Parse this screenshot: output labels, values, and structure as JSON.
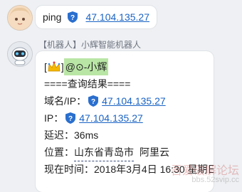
{
  "message1": {
    "text": "ping",
    "ip": "47.104.135.27"
  },
  "bot": {
    "sender_name": "【机器人】小辉智能机器人"
  },
  "message2": {
    "mention_open": "[",
    "mention_close": "]",
    "mention": "@⊙-小辉",
    "header": "====查询结果====",
    "domain_label": "域名/IP：",
    "domain_value": "47.104.135.27",
    "ip_label": "IP：",
    "ip_value": "47.104.135.27",
    "latency": "延迟：36ms",
    "location_label": "位置：",
    "location_value": "山东省青岛市",
    "location_provider": "阿里云",
    "time": "现在时间：2018年3月4日 16:30 星期日"
  },
  "watermark": {
    "line1": "吾爱破解论坛",
    "line2": "bbs.52svip.cc"
  },
  "colors": {
    "link": "#1a63c4",
    "mention_bg": "#b9e6a5",
    "shield": "#2a6fce"
  }
}
